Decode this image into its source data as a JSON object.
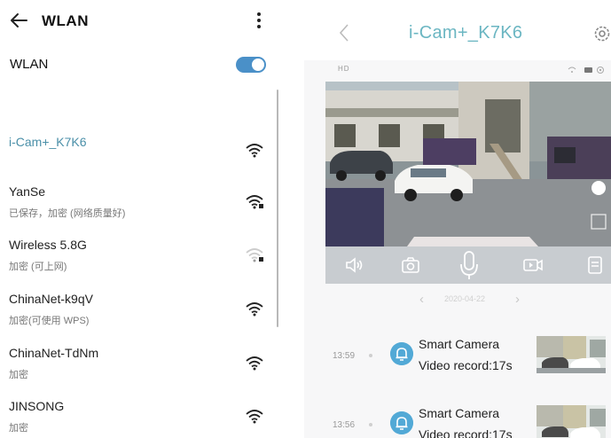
{
  "wlan_settings": {
    "title": "WLAN",
    "toggle_label": "WLAN",
    "toggle_on": true,
    "networks": [
      {
        "name": "i-Cam+_K7K6",
        "status": "",
        "connected": true
      },
      {
        "name": "YanSe",
        "status": "已保存，加密 (网络质量好)",
        "connected": false
      },
      {
        "name": "Wireless 5.8G",
        "status": "加密 (可上网)",
        "connected": false
      },
      {
        "name": "ChinaNet-k9qV",
        "status": "加密(可使用 WPS)",
        "connected": false
      },
      {
        "name": "ChinaNet-TdNm",
        "status": "加密",
        "connected": false
      },
      {
        "name": "JINSONG",
        "status": "加密",
        "connected": false
      }
    ]
  },
  "camera_app": {
    "title": "i-Cam+_K7K6",
    "quality": "HD",
    "date": "2020-04-22",
    "events": [
      {
        "time": "13:59",
        "title": "Smart Camera",
        "subtitle": "Video record:17s"
      },
      {
        "time": "13:56",
        "title": "Smart Camera",
        "subtitle": "Video record:17s"
      }
    ]
  },
  "colors": {
    "accent": "#4a90c8",
    "title_teal": "#6bb6c2",
    "event_icon": "#52a9d6"
  },
  "icons": [
    "back-arrow-icon",
    "more-vert-icon",
    "wifi-icon",
    "chevron-left-icon",
    "gear-icon",
    "speaker-icon",
    "camera-icon",
    "microphone-icon",
    "video-record-icon",
    "bell-icon"
  ]
}
